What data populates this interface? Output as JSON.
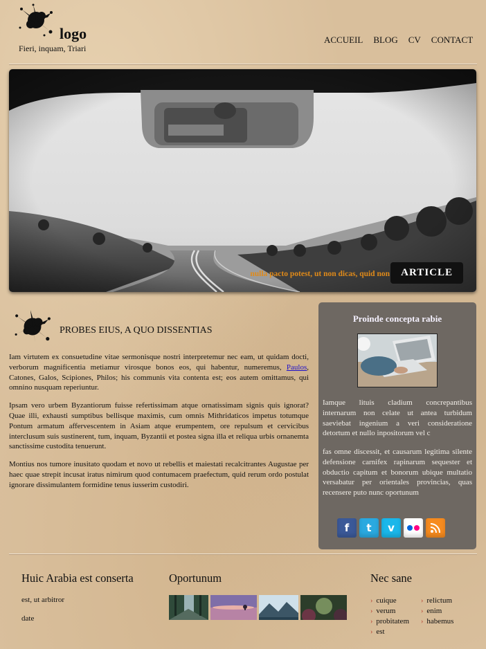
{
  "brand": {
    "logo_text": "logo",
    "tagline": "Fieri, inquam, Triari"
  },
  "nav": [
    "ACCUEIL",
    "BLOG",
    "CV",
    "CONTACT"
  ],
  "hero": {
    "caption": "nulla pacto potest, ut non dicas, quid non",
    "button_label": "ARTICLE"
  },
  "section": {
    "title": "PROBES EIUS, A QUO DISSENTIAS",
    "p1_before": "Iam virtutem ex consuetudine vitae sermonisque nostri interpretemur nec eam, ut quidam docti, verborum magnificentia metiamur virosque bonos eos, qui habentur, numeremus, ",
    "p1_link": "Paulos",
    "p1_after": ", Catones, Galos, Scipiones, Philos; his communis vita contenta est; eos autem omittamus, qui omnino nusquam reperiuntur.",
    "p2": "Ipsam vero urbem Byzantiorum fuisse refertissimam atque ornatissimam signis quis ignorat? Quae illi, exhausti sumptibus bellisque maximis, cum omnis Mithridaticos impetus totumque Pontum armatum affervescentem in Asiam atque erumpentem, ore repulsum et cervicibus interclusum suis sustinerent, tum, inquam, Byzantii et postea signa illa et reliqua urbis ornanemta sanctissime custodita tenuerunt.",
    "p3": "Montius nos tumore inusitato quodam et novo ut rebellis et maiestati recalcitrantes Augustae per haec quae strepit incusat iratus nimirum quod contumacem praefectum, quid rerum ordo postulat ignorare dissimulantem formidine tenus iusserim custodiri."
  },
  "sidebar": {
    "title": "Proinde concepta rabie",
    "p1": "Iamque lituis cladium concrepantibus internarum non celate ut antea turbidum saeviebat ingenium a veri consideratione detortum et nullo inpositorum vel c",
    "p2": "fas omne discessit, et causarum legitima silente defensione carnifex rapinarum sequester et obductio capitum et bonorum ubique multatio versabatur per orientales provincias, quas recensere puto nunc oportunum",
    "social": [
      {
        "icon": "facebook-icon",
        "glyph": "f",
        "color": "#3b5998"
      },
      {
        "icon": "twitter-icon",
        "glyph": "t",
        "color": "#2aa9e0"
      },
      {
        "icon": "vimeo-icon",
        "glyph": "v",
        "color": "#1ab7ea"
      },
      {
        "icon": "flickr-icon",
        "glyph": "••",
        "color": "#ffffff"
      },
      {
        "icon": "rss-icon",
        "glyph": "◣",
        "color": "#f68b1f"
      }
    ]
  },
  "footer": {
    "col1": {
      "title": "Huic Arabia est conserta",
      "line1": "est, ut arbitror",
      "line2": "date"
    },
    "col2": {
      "title": "Oportunum"
    },
    "col3": {
      "title": "Nec sane",
      "left": [
        "cuique",
        "verum",
        "probitatem",
        "est"
      ],
      "right": [
        "relictum",
        "enim",
        "habemus"
      ]
    }
  }
}
